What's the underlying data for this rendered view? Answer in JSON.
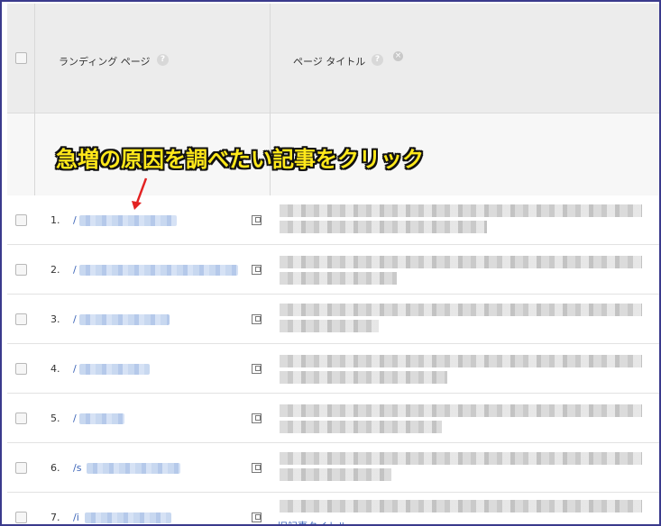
{
  "header": {
    "col_landing_page": "ランディング ページ",
    "col_page_title": "ページ タイトル",
    "help_glyph": "?",
    "remove_glyph": "×"
  },
  "annotation": {
    "text": "急増の原因を調べたい記事をクリック",
    "text_color": "#ffe81a",
    "arrow_color": "#e32222"
  },
  "rows": [
    {
      "num": "1.",
      "path": "/"
    },
    {
      "num": "2.",
      "path": "/"
    },
    {
      "num": "3.",
      "path": "/"
    },
    {
      "num": "4.",
      "path": "/"
    },
    {
      "num": "5.",
      "path": "/"
    },
    {
      "num": "6.",
      "path": "/s"
    },
    {
      "num": "7.",
      "path": "/i"
    }
  ],
  "footer_link": "旧記事タイトル",
  "colors": {
    "link": "#3b64b8",
    "header_bg": "#ececec",
    "border": "#3a3a8c"
  }
}
